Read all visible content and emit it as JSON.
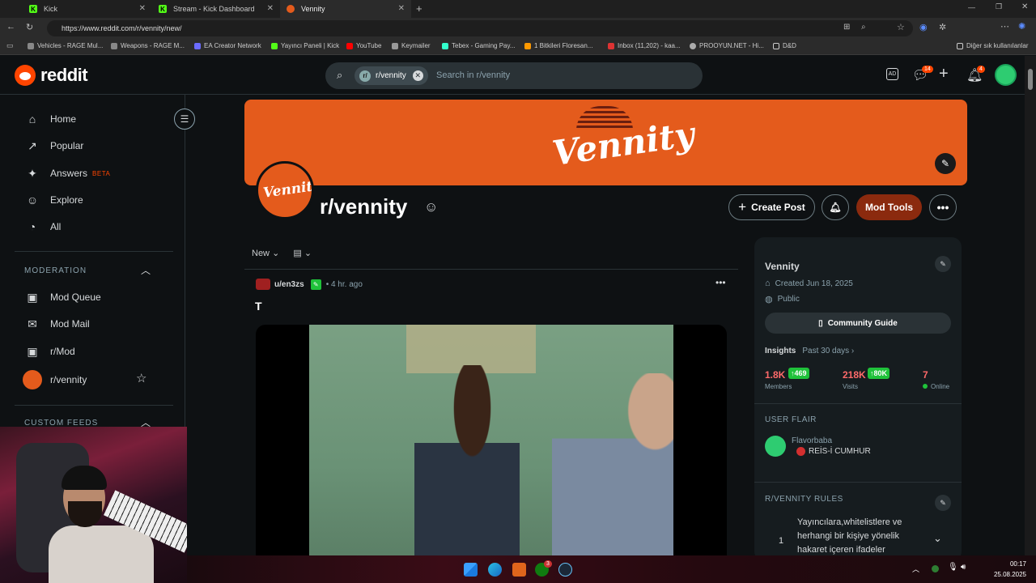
{
  "browser": {
    "tabs": [
      {
        "title": "Kick",
        "color": "#53fc18"
      },
      {
        "title": "Stream - Kick Dashboard",
        "color": "#53fc18"
      },
      {
        "title": "Vennity",
        "color": "#e45b1c"
      }
    ],
    "url": "https://www.reddit.com/r/vennity/new/",
    "bookmarks": [
      "Vehicles - RAGE Mul...",
      "Weapons - RAGE M...",
      "EA Creator Network",
      "Yayıncı Paneli | Kick",
      "YouTube",
      "Keymailer",
      "Tebex - Gaming Pay...",
      "1 Bitkileri Floresan...",
      "Inbox (11,202) - kaa...",
      "PROOYUN.NET - Hi...",
      "D&D"
    ],
    "other_bookmarks": "Diğer sık kullanılanlar"
  },
  "header": {
    "logo": "reddit",
    "search_chip": "r/vennity",
    "search_placeholder": "Search in r/vennity",
    "chat_badge": "14",
    "notif_badge": "4"
  },
  "sidebar": {
    "items": [
      {
        "label": "Home",
        "icon": "⌂"
      },
      {
        "label": "Popular",
        "icon": "↗"
      },
      {
        "label": "Answers",
        "icon": "✦"
      },
      {
        "label": "Explore",
        "icon": "☺"
      },
      {
        "label": "All",
        "icon": "◔"
      }
    ],
    "answers_beta": "BETA",
    "moderation_head": "MODERATION",
    "mod_items": [
      {
        "label": "Mod Queue"
      },
      {
        "label": "Mod Mail"
      },
      {
        "label": "r/Mod"
      },
      {
        "label": "r/vennity"
      }
    ],
    "custom_feeds_head": "CUSTOM FEEDS"
  },
  "sub": {
    "name": "r/vennity",
    "banner_text": "Vennity",
    "avatar_text": "Vennity",
    "create_post": "Create Post",
    "mod_tools": "Mod Tools",
    "accent": "#e45b1c",
    "mod_tools_color": "#8b2a0e"
  },
  "feed": {
    "sort": "New",
    "post": {
      "author": "u/en3zs",
      "time": "• 4 hr. ago",
      "title": "T"
    }
  },
  "panel": {
    "name": "Vennity",
    "created": "Created Jun 18, 2025",
    "visibility": "Public",
    "guide_button": "Community Guide",
    "insights": "Insights",
    "insights_range": "Past 30 days ›",
    "stats": [
      {
        "value": "1.8K",
        "delta": "↑469",
        "label": "Members"
      },
      {
        "value": "218K",
        "delta": "↑80K",
        "label": "Visits"
      },
      {
        "value": "7",
        "label": "Online"
      }
    ],
    "flair_head": "USER FLAIR",
    "flair_user": "Flavorbaba",
    "flair_text": "REİS-İ CUMHUR",
    "rules_head": "R/VENNITY RULES",
    "rule_1_num": "1",
    "rule_1_text": "Yayıncılara,whitelistlere ve herhangi bir kişiye yönelik hakaret içeren ifadeler"
  },
  "taskbar": {
    "time": "00:17",
    "date": "25.08.2025",
    "xbox_badge": "3"
  }
}
